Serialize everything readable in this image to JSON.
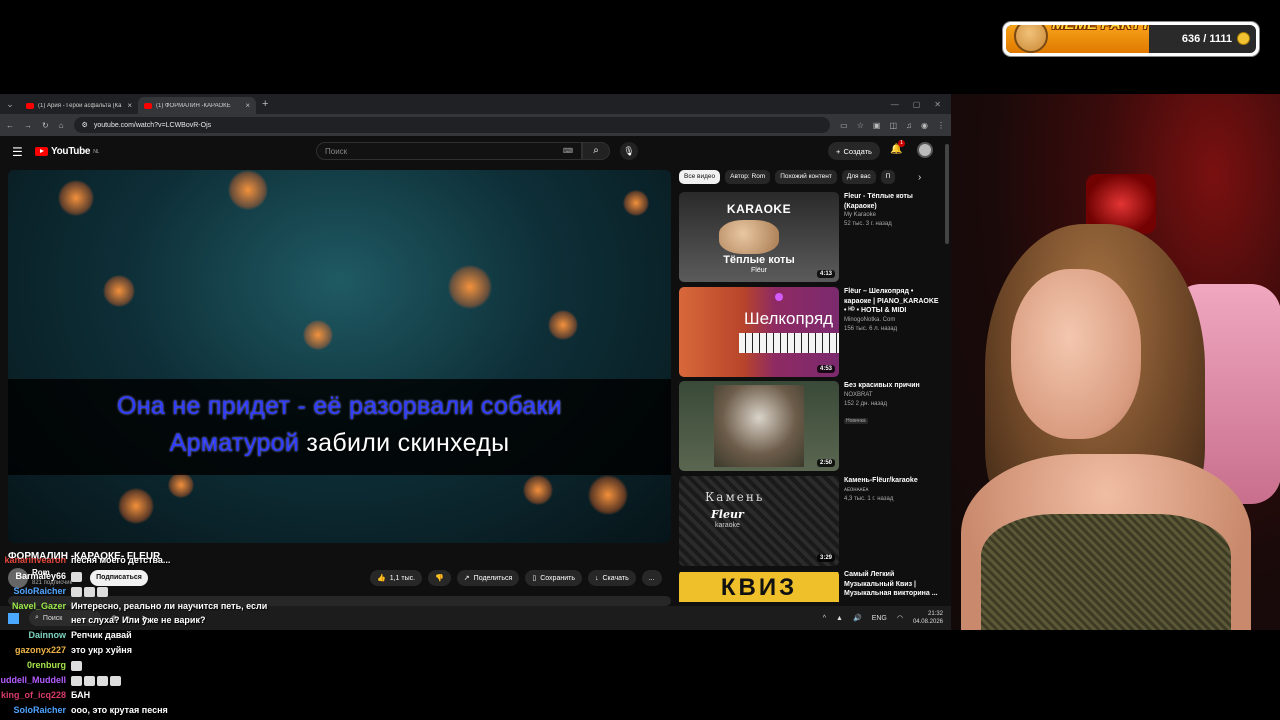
{
  "meme_party": {
    "title": "MEME PARTY",
    "count": "636 / 1111",
    "progress": 0.57,
    "colors": {
      "fill": "#f09000",
      "title": "#ffd83a"
    }
  },
  "browser": {
    "tabs": [
      {
        "label": "(1) Ария - Герой асфальта (Ка",
        "active": false
      },
      {
        "label": "(1) ФОРМАЛИН -КАРАОКЕ",
        "active": true
      }
    ],
    "new_tab": "+",
    "url": "youtube.com/watch?v=LCWBovR-Ojs"
  },
  "youtube": {
    "logo": "YouTube",
    "logo_region": "NL",
    "search_placeholder": "Поиск",
    "create_label": "Создать",
    "notif_count": "1",
    "lyrics": {
      "line1": "Она не придет - её разорвали собаки",
      "line2_sung": "Арматурой",
      "line2_rest": " забили скинхеды"
    },
    "video_title": "ФОРМАЛИН -КАРАОКЕ- FLEUR",
    "channel_name": "Rom",
    "channel_subs": "821 подписчик",
    "subscribe_label": "Подписаться",
    "actions": {
      "likes": "1,1 тыс.",
      "share": "Поделиться",
      "save": "Сохранить",
      "download": "Скачать",
      "more": "..."
    },
    "chips": [
      "Все видео",
      "Автор: Rom",
      "Похожий контент",
      "Для вас",
      "П"
    ],
    "recommendations": [
      {
        "title": "Fleur - Тёплые коты (Караоке)",
        "channel": "My Karaoke",
        "stats": "52 тыс.  3 г. назад",
        "duration": "4:13",
        "badge": "",
        "thumb_text_1": "KARAOKE",
        "thumb_text_2": "Тёплые коты",
        "thumb_text_3": "Flёur"
      },
      {
        "title": "Flёur – Шелкопряд • караоке | PIANO_KARAOKE • ᴴᴰ • НОТЫ & MIDI",
        "channel": "MinogoNotka. Com",
        "stats": "156 тыс.  6 л. назад",
        "duration": "4:53",
        "badge": "",
        "thumb_text_1": "Шелкопряд",
        "thumb_text_2": "",
        "thumb_text_3": ""
      },
      {
        "title": "Без красивых причин",
        "channel": "NOXBRAT",
        "stats": "152  2 дн. назад",
        "duration": "2:50",
        "badge": "Новинка",
        "thumb_text_1": "",
        "thumb_text_2": "",
        "thumb_text_3": ""
      },
      {
        "title": "Камень-Flёur/karaoke",
        "channel": "ᴀᴇᴏʜᴀᴀᴇᴀ",
        "stats": "4,3 тыс.  1 г. назад",
        "duration": "3:29",
        "badge": "",
        "thumb_text_1": "Камень",
        "thumb_text_2": "Fleur",
        "thumb_text_3": "karaoke"
      },
      {
        "title": "Самый Легкий Музыкальный Квиз | Музыкальная викторина ...",
        "channel": "",
        "stats": "",
        "duration": "",
        "badge": "",
        "thumb_text_1": "КВИЗ",
        "thumb_text_2": "",
        "thumb_text_3": ""
      }
    ]
  },
  "taskbar": {
    "search": "Поиск",
    "lang": "ENG",
    "time": "21:32",
    "date": "04.08.2026"
  },
  "chat": [
    {
      "user": "kanarinvearon",
      "text": "песня моего детства...",
      "color": "#e0443a"
    },
    {
      "user": "Barmaley66",
      "text": "",
      "color": "#ffffff"
    },
    {
      "user": "SoloRaicher",
      "text": "",
      "color": "#4fa3ff"
    },
    {
      "user": "Navel_Gazer",
      "text": "Интересно, реально ли научится петь, если",
      "color": "#9be84a"
    },
    {
      "user": "",
      "text": "нет слуха? Или уже не варик?",
      "color": "#ffffff"
    },
    {
      "user": "Dainnow",
      "text": "Репчик давай",
      "color": "#7fd6c2"
    },
    {
      "user": "gazonyx227",
      "text": "это укр хуйня",
      "color": "#f0b54a"
    },
    {
      "user": "0renburg",
      "text": "",
      "color": "#a6e34a"
    },
    {
      "user": "uddell_Muddell",
      "text": "",
      "color": "#b45cff"
    },
    {
      "user": "king_of_icq228",
      "text": "БАН",
      "color": "#d93b6b"
    },
    {
      "user": "SoloRaicher",
      "text": "ооо, это крутая песня",
      "color": "#4fa3ff"
    }
  ]
}
